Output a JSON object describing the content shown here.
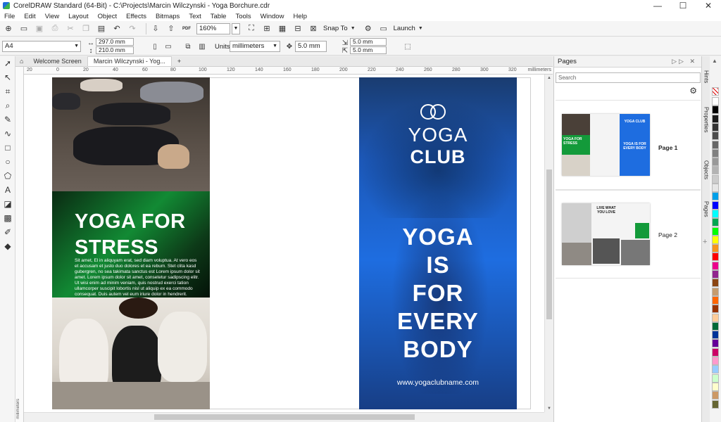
{
  "window": {
    "title": "CorelDRAW Standard (64-Bit) - C:\\Projects\\Marcin Wilczynski - Yoga Borchure.cdr",
    "minimize": "—",
    "maximize": "☐",
    "close": "✕"
  },
  "menu": [
    "File",
    "Edit",
    "View",
    "Layout",
    "Object",
    "Effects",
    "Bitmaps",
    "Text",
    "Table",
    "Tools",
    "Window",
    "Help"
  ],
  "toolbar": {
    "zoom": "160%",
    "snap_to": "Snap To",
    "launch": "Launch",
    "pdf": "PDF"
  },
  "propbar": {
    "page_size": "A4",
    "width": "297.0 mm",
    "height": "210.0 mm",
    "units_label": "Units:",
    "units": "millimeters",
    "nudge": "5.0 mm",
    "dup_x": "5.0 mm",
    "dup_y": "5.0 mm"
  },
  "tabs": [
    {
      "label": "Welcome Screen"
    },
    {
      "label": "Marcin Wilczynski - Yog..."
    }
  ],
  "ruler": {
    "ticks": [
      "20",
      "0",
      "20",
      "40",
      "60",
      "80",
      "100",
      "120",
      "140",
      "160",
      "180",
      "200",
      "220",
      "240",
      "260",
      "280",
      "300",
      "320"
    ],
    "unit": "millimeters",
    "v_unit": "millimeters"
  },
  "brochure": {
    "left_title_lines": [
      "YOGA FOR",
      "STRESS"
    ],
    "left_body": "Sit amet, El in aliquyam erat, sed diam voluptua. At vero eos et accusam et justo duo dolores et ea rebum. Stet clita kasd gubergren, no sea takimata sanctus est Lorem ipsum dolor sit amet. Lorem ipsum dolor sit amet, consetetur sadipscing elitr. Ut wisi enim ad minim veniam, quis nostrud exerci tation ullamcorper suscipit lobortis nisl ut aliquip ex ea commodo consequat. Duis autem vel eum iriure dolor in hendrerit.",
    "logo_word": "YOGA",
    "logo_club": "CLUB",
    "slogan_lines": [
      "YOGA",
      "IS",
      "FOR",
      "EVERY",
      "BODY"
    ],
    "url": "www.yogaclubname.com"
  },
  "pages_docker": {
    "title": "Pages",
    "search_placeholder": "Search",
    "pages": [
      {
        "label": "Page 1",
        "thumb_text": [
          "YOGA FOR STRESS",
          "YOGA CLUB",
          "YOGA IS FOR EVERY BODY"
        ]
      },
      {
        "label": "Page 2",
        "thumb_text": [
          "LIVE WHAT YOU LOVE"
        ]
      }
    ]
  },
  "side_tabs": [
    "Hints",
    "Properties",
    "Objects",
    "Pages"
  ],
  "palette": [
    "#ffffff",
    "#000000",
    "#1a1a1a",
    "#333333",
    "#4d4d4d",
    "#666666",
    "#808080",
    "#999999",
    "#b3b3b3",
    "#cccccc",
    "#e6e6e6",
    "#00a0e9",
    "#0000ff",
    "#00ffff",
    "#00a651",
    "#00ff00",
    "#ffff00",
    "#f7941d",
    "#ff0000",
    "#ec008c",
    "#92278f",
    "#8b4513",
    "#c69c6d",
    "#ff6600",
    "#993300",
    "#ffcc99",
    "#006837",
    "#003399",
    "#660099",
    "#cc0066",
    "#ff99cc",
    "#99ccff",
    "#ccffcc",
    "#ffffcc",
    "#cc9966",
    "#666633"
  ],
  "colors": {
    "green_panel": "#128a34",
    "blue_panel": "#1e6de0"
  }
}
